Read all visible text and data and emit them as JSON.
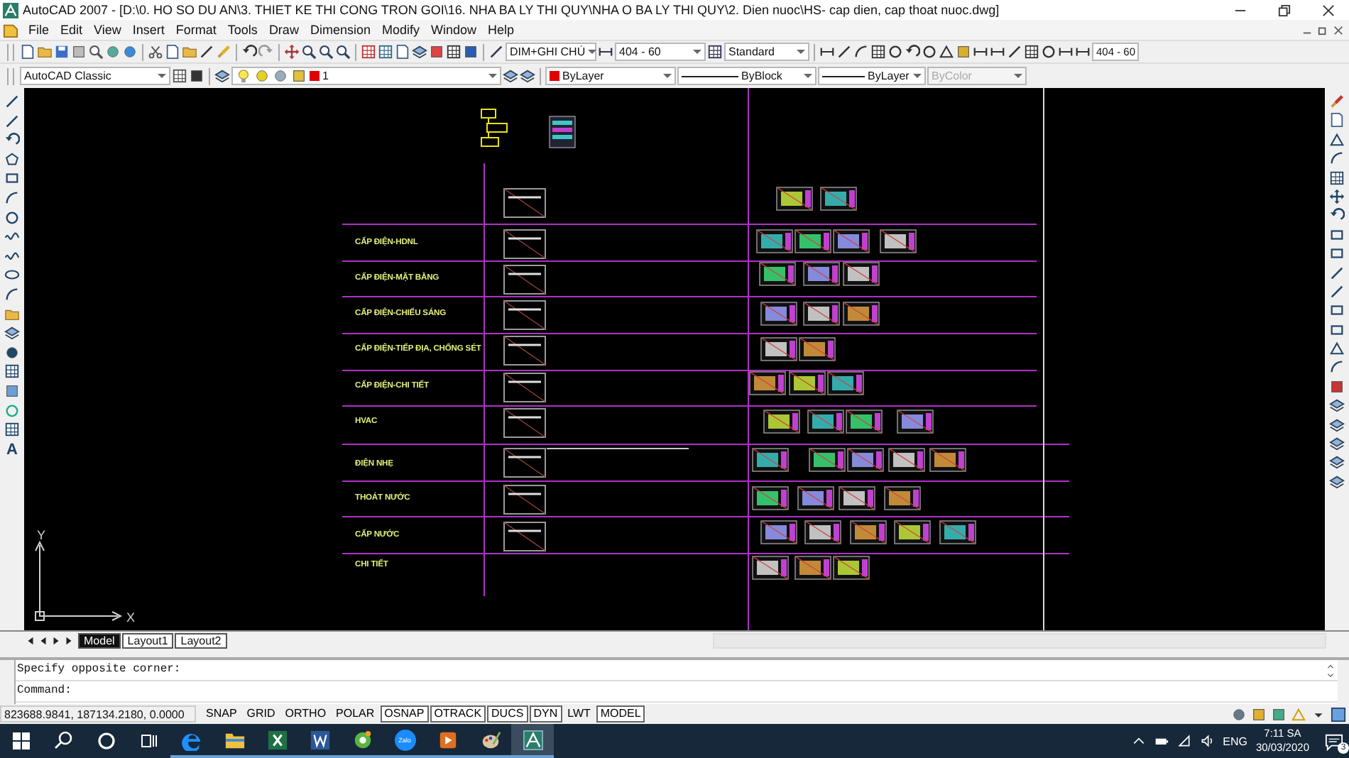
{
  "window": {
    "title": "AutoCAD 2007 - [D:\\0. HO SO DU AN\\3. THIET KE THI CONG TRON GOI\\16. NHA BA LY THI QUY\\NHA O BA LY THI QUY\\2. Dien nuoc\\HS-  cap dien, cap thoat nuoc.dwg]"
  },
  "menu": [
    "File",
    "Edit",
    "View",
    "Insert",
    "Format",
    "Tools",
    "Draw",
    "Dimension",
    "Modify",
    "Window",
    "Help"
  ],
  "styles_toolbar": {
    "text_style": "DIM+GHI CHÚ",
    "dim_style": "404 - 60",
    "table_style": "Standard",
    "dim_style_right": "404 - 60"
  },
  "properties_toolbar": {
    "workspace": "AutoCAD Classic",
    "layer": "1",
    "color_control": "ByLayer",
    "linetype": "ByBlock",
    "lineweight": "ByLayer",
    "plot_style": {
      "value": "ByColor",
      "disabled": true
    }
  },
  "draw_toolbar": {
    "mtext_tool": "A"
  },
  "drawing": {
    "rows": [
      "CẤP ĐIỆN-HDNL",
      "CẤP ĐIỆN-MẶT BẰNG",
      "CẤP ĐIỆN-CHIẾU SÁNG",
      "CẤP ĐIỆN-TIẾP ĐỊA, CHỐNG SÉT",
      "CẤP ĐIỆN-CHI TIẾT",
      "HVAC",
      "ĐIỆN NHẸ",
      "THOÁT NƯỚC",
      "CẤP NƯỚC",
      "CHI TIẾT"
    ],
    "ucs": {
      "x": "X",
      "y": "Y"
    }
  },
  "layout_tabs": [
    {
      "label": "Model",
      "selected": true
    },
    {
      "label": "Layout1",
      "selected": false
    },
    {
      "label": "Layout2",
      "selected": false
    }
  ],
  "command_lines": [
    "Specify opposite corner:",
    "Command:"
  ],
  "status_bar": {
    "coordinates": "823688.9841, 187134.2180, 0.0000",
    "toggles": [
      {
        "label": "SNAP",
        "on": false
      },
      {
        "label": "GRID",
        "on": false
      },
      {
        "label": "ORTHO",
        "on": false
      },
      {
        "label": "POLAR",
        "on": false
      },
      {
        "label": "OSNAP",
        "on": true
      },
      {
        "label": "OTRACK",
        "on": true
      },
      {
        "label": "DUCS",
        "on": true
      },
      {
        "label": "DYN",
        "on": true
      },
      {
        "label": "LWT",
        "on": false
      },
      {
        "label": "MODEL",
        "on": true
      }
    ]
  },
  "taskbar": {
    "apps": [
      {
        "kind": "edge",
        "selected": false
      },
      {
        "kind": "explorer",
        "selected": false
      },
      {
        "kind": "excel",
        "selected": false
      },
      {
        "kind": "word",
        "selected": false
      },
      {
        "kind": "green-app",
        "selected": false
      },
      {
        "kind": "zalo",
        "selected": false,
        "label": "Zalo"
      },
      {
        "kind": "player",
        "selected": false
      },
      {
        "kind": "paint",
        "selected": false
      },
      {
        "kind": "autocad",
        "selected": true
      }
    ],
    "language": "ENG",
    "time": "7:11 SA",
    "date": "30/03/2020",
    "notification_count": "3"
  }
}
